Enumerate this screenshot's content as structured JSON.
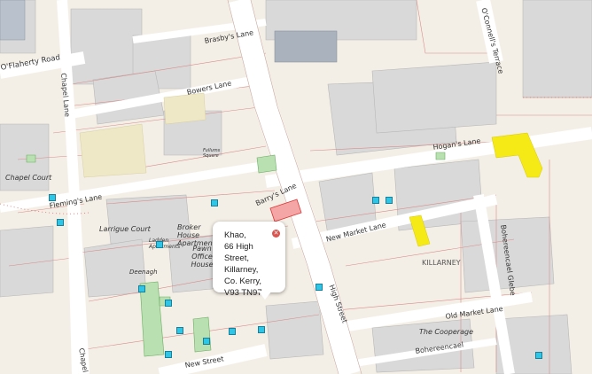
{
  "map": {
    "streets": {
      "oflaherty_road": "O'Flaherty Road",
      "chapel_lane": "Chapel Lane",
      "brasbys_lane": "Brasby's Lane",
      "bowers_lane": "Bowers Lane",
      "flemings_lane": "Fleming's Lane",
      "barrys_lane": "Barry's Lane",
      "hogans_lane": "Hogan's Lane",
      "new_market_lane": "New Market Lane",
      "high_street": "High Street",
      "old_market_lane": "Old Market Lane",
      "bohereencael": "Bohereencael",
      "bohereencael_glebe": "Bohereencael Glebe",
      "oconnells_terrace": "O'Connell's Terrace",
      "new_street": "New Street",
      "chapel_bottom": "Chapel"
    },
    "places": {
      "chapel_court": "Chapel Court",
      "larrigue_court": "Larrigue Court",
      "broker_house_apartments": "Broker House Apartments",
      "pawn_office_house": "Pawn Office House",
      "ladden_apartments": "Ladden Apartments",
      "deenagh": "Deenagh",
      "the_cooperage": "The Cooperage",
      "killarney": "KILLARNEY",
      "fullum_area": "Fullums Square"
    }
  },
  "popup": {
    "name": "Khao,",
    "street": "66 High Street,",
    "town": "Killarney,",
    "county": "Co. Kerry,",
    "eircode": "V93 TN97",
    "close_icon": "close-icon"
  },
  "colors": {
    "highlight_yellow": "#f5ea16",
    "selected_parcel": "#f4a6a6",
    "marker": "#2ec6e6",
    "green_area": "#b8e0b0"
  }
}
